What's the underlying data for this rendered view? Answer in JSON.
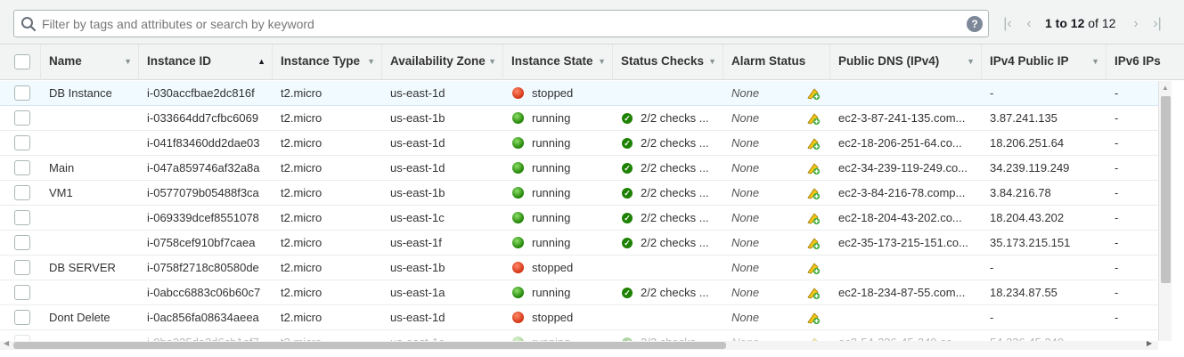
{
  "search": {
    "placeholder": "Filter by tags and attributes or search by keyword"
  },
  "pagination": {
    "range": "1 to 12",
    "of_label": "of 12"
  },
  "columns": [
    "Name",
    "Instance ID",
    "Instance Type",
    "Availability Zone",
    "Instance State",
    "Status Checks",
    "Alarm Status",
    "Public DNS (IPv4)",
    "IPv4 Public IP",
    "IPv6 IPs"
  ],
  "sorted_column": "Instance ID",
  "status_colors": {
    "stopped": "#d13212",
    "running": "#1d8102"
  },
  "icons": {
    "search": "search-icon",
    "help": "help-icon",
    "first": "first-page-icon",
    "prev": "previous-page-icon",
    "next": "next-page-icon",
    "last": "last-page-icon",
    "alarm": "add-alarm-icon",
    "check": "check-circle-icon"
  },
  "rows": [
    {
      "name": "DB Instance",
      "id": "i-030accfbae2dc816f",
      "type": "t2.micro",
      "az": "us-east-1d",
      "state": "stopped",
      "checks": "",
      "alarm": "None",
      "dns": "",
      "ip": "-",
      "ipv6": "-",
      "selected": true
    },
    {
      "name": "",
      "id": "i-033664dd7cfbc6069",
      "type": "t2.micro",
      "az": "us-east-1b",
      "state": "running",
      "checks": "2/2 checks ...",
      "alarm": "None",
      "dns": "ec2-3-87-241-135.com...",
      "ip": "3.87.241.135",
      "ipv6": "-"
    },
    {
      "name": "",
      "id": "i-041f83460dd2dae03",
      "type": "t2.micro",
      "az": "us-east-1d",
      "state": "running",
      "checks": "2/2 checks ...",
      "alarm": "None",
      "dns": "ec2-18-206-251-64.co...",
      "ip": "18.206.251.64",
      "ipv6": "-"
    },
    {
      "name": "Main",
      "id": "i-047a859746af32a8a",
      "type": "t2.micro",
      "az": "us-east-1d",
      "state": "running",
      "checks": "2/2 checks ...",
      "alarm": "None",
      "dns": "ec2-34-239-119-249.co...",
      "ip": "34.239.119.249",
      "ipv6": "-"
    },
    {
      "name": "VM1",
      "id": "i-0577079b05488f3ca",
      "type": "t2.micro",
      "az": "us-east-1b",
      "state": "running",
      "checks": "2/2 checks ...",
      "alarm": "None",
      "dns": "ec2-3-84-216-78.comp...",
      "ip": "3.84.216.78",
      "ipv6": "-"
    },
    {
      "name": "",
      "id": "i-069339dcef8551078",
      "type": "t2.micro",
      "az": "us-east-1c",
      "state": "running",
      "checks": "2/2 checks ...",
      "alarm": "None",
      "dns": "ec2-18-204-43-202.co...",
      "ip": "18.204.43.202",
      "ipv6": "-"
    },
    {
      "name": "",
      "id": "i-0758cef910bf7caea",
      "type": "t2.micro",
      "az": "us-east-1f",
      "state": "running",
      "checks": "2/2 checks ...",
      "alarm": "None",
      "dns": "ec2-35-173-215-151.co...",
      "ip": "35.173.215.151",
      "ipv6": "-"
    },
    {
      "name": "DB SERVER",
      "id": "i-0758f2718c80580de",
      "type": "t2.micro",
      "az": "us-east-1b",
      "state": "stopped",
      "checks": "",
      "alarm": "None",
      "dns": "",
      "ip": "-",
      "ipv6": "-"
    },
    {
      "name": "",
      "id": "i-0abcc6883c06b60c7",
      "type": "t2.micro",
      "az": "us-east-1a",
      "state": "running",
      "checks": "2/2 checks ...",
      "alarm": "None",
      "dns": "ec2-18-234-87-55.com...",
      "ip": "18.234.87.55",
      "ipv6": "-"
    },
    {
      "name": "Dont Delete",
      "id": "i-0ac856fa08634aeea",
      "type": "t2.micro",
      "az": "us-east-1d",
      "state": "stopped",
      "checks": "",
      "alarm": "None",
      "dns": "",
      "ip": "-",
      "ipv6": "-"
    },
    {
      "name": "",
      "id": "i-0be235da3d6cb1ef7",
      "type": "t2.micro",
      "az": "us-east-1e",
      "state": "running",
      "checks": "2/2 checks ...",
      "alarm": "None",
      "dns": "ec2-54-236-45-240.co...",
      "ip": "54.236.45.240",
      "ipv6": "-",
      "faded": true
    }
  ]
}
